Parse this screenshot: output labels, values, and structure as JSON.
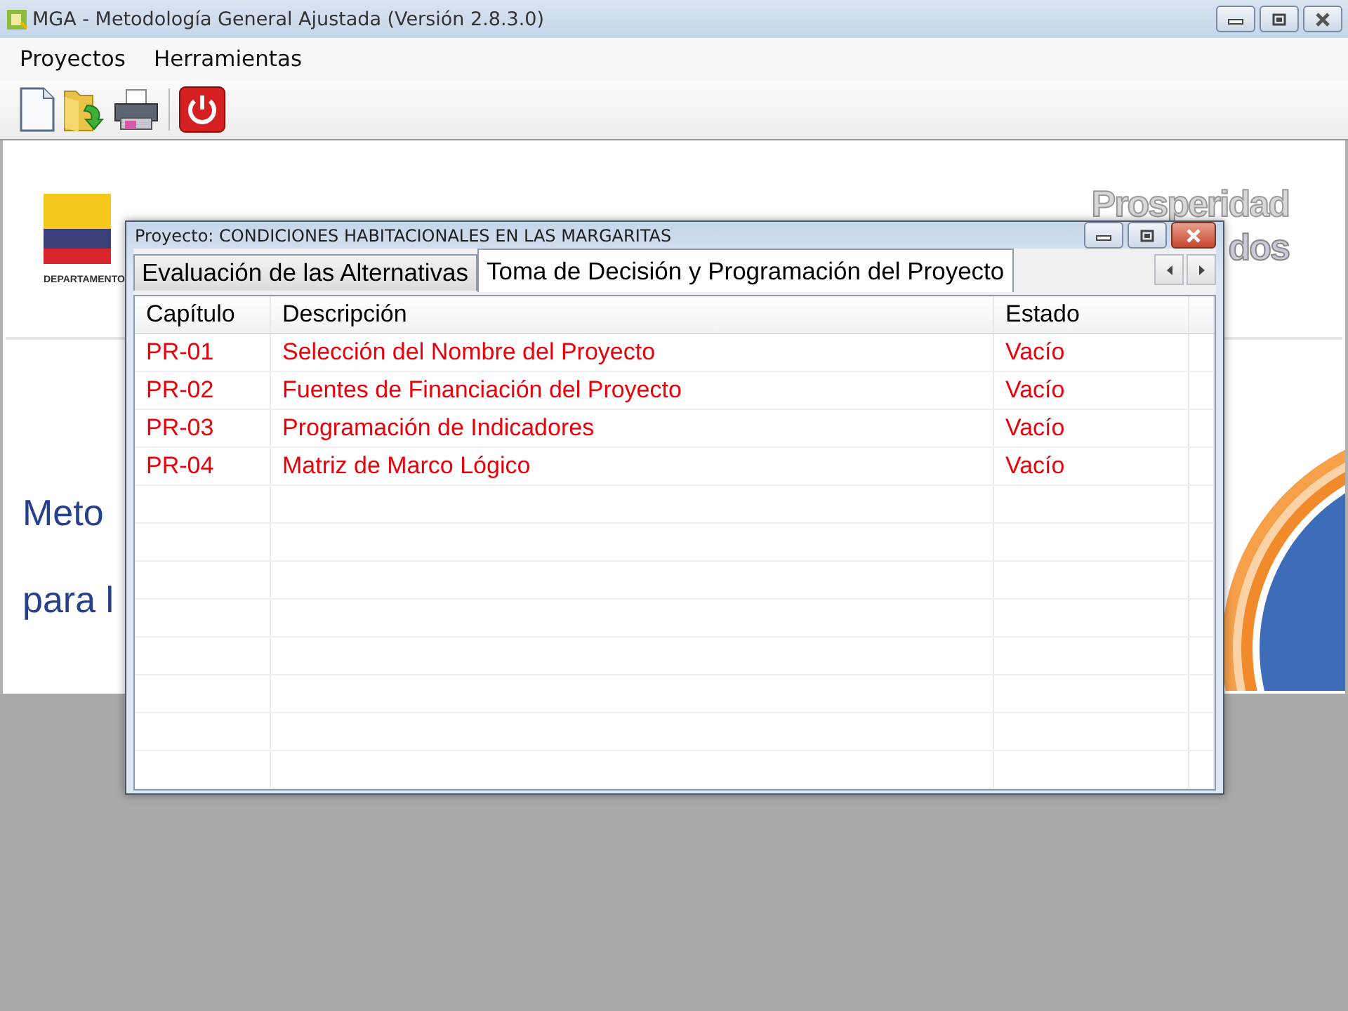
{
  "window": {
    "title": "MGA - Metodología General Ajustada (Versión 2.8.3.0)"
  },
  "menu": [
    {
      "label": "Proyectos"
    },
    {
      "label": "Herramientas"
    }
  ],
  "background": {
    "department_label": "DEPARTAMENTO",
    "slogan_top": "Prosperidad",
    "slogan_bottom": "dos",
    "heading_lines": [
      "Meto",
      "para l"
    ]
  },
  "dialog": {
    "title": "Proyecto: CONDICIONES HABITACIONALES EN LAS MARGARITAS",
    "tabs": [
      {
        "label": "Evaluación de las Alternativas",
        "selected": false
      },
      {
        "label": "Toma de Decisión y Programación del Proyecto",
        "selected": true
      }
    ],
    "table": {
      "columns": [
        "Capítulo",
        "Descripción",
        "Estado"
      ],
      "rows": [
        {
          "cells": [
            "PR-01",
            "Selección del Nombre del Proyecto",
            "Vacío"
          ]
        },
        {
          "cells": [
            "PR-02",
            "Fuentes de Financiación del Proyecto",
            "Vacío"
          ]
        },
        {
          "cells": [
            "PR-03",
            "Programación de Indicadores",
            "Vacío"
          ]
        },
        {
          "cells": [
            "PR-04",
            "Matriz de Marco Lógico",
            "Vacío"
          ]
        }
      ]
    }
  }
}
